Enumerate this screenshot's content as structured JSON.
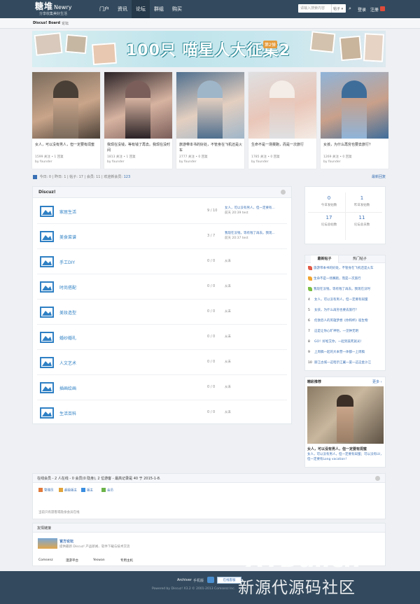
{
  "header": {
    "logo_main": "糖堆",
    "logo_en": "Newry",
    "logo_sub": "分享收集美好生活",
    "nav": [
      "门户",
      "资讯",
      "论坛",
      "群组",
      "购买"
    ],
    "nav_active_index": 2,
    "search_placeholder": "请输入搜索内容",
    "search_scope": "帖子",
    "login": "登录",
    "register": "注册"
  },
  "breadcrumb": {
    "home": "Discuz! Board",
    "sep": "›",
    "current": "论坛"
  },
  "banner": {
    "title": "100只 喵星人大征集2",
    "issue": "第2弹"
  },
  "featured": [
    {
      "title": "女人，可以没有男人，但一定要有闺蜜",
      "meta": "1599 关注 • 1 回复",
      "by": "by founder",
      "colors": [
        "#7a6b5c",
        "#c9a58a",
        "#4a3f36"
      ]
    },
    {
      "title": "我现在没钱，等有钱了再去。我现在没时间",
      "meta": "1813 关注 • 1 回复",
      "by": "by founder",
      "colors": [
        "#2a2226",
        "#d7b3a1",
        "#7b5e5a"
      ]
    },
    {
      "title": "旅游带本书的好处，不管身在飞机还是火车",
      "meta": "2777 关注 • 0 回复",
      "by": "by founder",
      "colors": [
        "#4f6f8e",
        "#e4cfc0",
        "#9fb6c9"
      ]
    },
    {
      "title": "生命不是一场赛跑，而是一次旅行",
      "meta": "1785 关注 • 0 回复",
      "by": "by founder",
      "colors": [
        "#dfe0e2",
        "#e9c6b8",
        "#f4ece6"
      ]
    },
    {
      "title": "女孩，为什么再穷也要去旅行？",
      "meta": "1269 关注 • 0 回复",
      "by": "by founder",
      "colors": [
        "#8fb4d9",
        "#c9a08a",
        "#3f6d9a"
      ]
    }
  ],
  "stats": {
    "today_label": "今日:",
    "today": "0",
    "yesterday_label": "昨日:",
    "yesterday": "1",
    "posts_label": "帖子:",
    "posts": "17",
    "members_label": "会员:",
    "members": "11",
    "welcome_label": "欢迎新会员:",
    "welcome": "123",
    "newest": "最新回复"
  },
  "forum": {
    "title": "Discuz!",
    "rows": [
      {
        "name": "家居生活",
        "count": "9 / 10",
        "last": "女人，可以没有男人，但一定要有...",
        "last_meta": "前天 20:39 test"
      },
      {
        "name": "美食菜谱",
        "count": "3 / 7",
        "last": "我现在没钱，等有钱了再去。我现...",
        "last_meta": "前天 20:37 test"
      },
      {
        "name": "手工DIY",
        "count": "0 / 0",
        "last": "从未",
        "last_meta": ""
      },
      {
        "name": "时尚搭配",
        "count": "0 / 0",
        "last": "从未",
        "last_meta": ""
      },
      {
        "name": "美妆造型",
        "count": "0 / 0",
        "last": "从未",
        "last_meta": ""
      },
      {
        "name": "婚纱婚礼",
        "count": "0 / 0",
        "last": "从未",
        "last_meta": ""
      },
      {
        "name": "人文艺术",
        "count": "0 / 0",
        "last": "从未",
        "last_meta": ""
      },
      {
        "name": "插画绘画",
        "count": "0 / 0",
        "last": "从未",
        "last_meta": ""
      },
      {
        "name": "生活百科",
        "count": "0 / 0",
        "last": "从未",
        "last_meta": ""
      }
    ]
  },
  "side_stats": [
    {
      "num": "0",
      "label": "今日发帖数"
    },
    {
      "num": "1",
      "label": "昨日发帖数"
    },
    {
      "num": "17",
      "label": "论坛总帖数"
    },
    {
      "num": "11",
      "label": "论坛总员数"
    }
  ],
  "hot_tabs": {
    "active": "最新帖子",
    "other": "热门帖子"
  },
  "hot_posts": [
    {
      "rank": "",
      "title": "旅游带本书的好处，不管身在飞机还是火车",
      "leaf": "#e05a47"
    },
    {
      "rank": "",
      "title": "生命不是一场赛跑，而是一次旅行",
      "leaf": "#f0a531"
    },
    {
      "rank": "",
      "title": "我现在没钱，等有钱了再去。我现在没时",
      "leaf": "#7bbf45"
    },
    {
      "rank": "4",
      "title": "女人，可以没有男人，但一定要有闺蜜",
      "leaf": ""
    },
    {
      "rank": "5",
      "title": "女孩，为什么再穷也要去旅行？",
      "leaf": ""
    },
    {
      "rank": "6",
      "title": "伦敦恐人的英雄梦想《你和杯》宿生物",
      "leaf": ""
    },
    {
      "rank": "7",
      "title": "这是让你心旷神怡，一见钟无明",
      "leaf": ""
    },
    {
      "rank": "8",
      "title": "GO！好松艾你，一起到美死就光！",
      "leaf": ""
    },
    {
      "rank": "9",
      "title": "上周稿一起的大本营一体都一上周稿",
      "leaf": ""
    },
    {
      "rank": "10",
      "title": "丽江古城一这昭示江翼一渠一这这金沙江",
      "leaf": ""
    }
  ],
  "recommend": {
    "title": "精彩推荐",
    "more": "更多 ›",
    "post_title": "女人，可以没有男人，但一定要有闺蜜",
    "post_desc": "女人，可以没有男人，但一定要有闺蜜；可以没有LV，但一定要有Long vacation！"
  },
  "online": {
    "title": "在线会员 - 2 人在线 - 0 会员(0 隐身), 2 位游客 - 最高记录是 40 于 2015-1-8.",
    "legend": [
      {
        "label": "管理员",
        "color": "#e07a3b"
      },
      {
        "label": "超级版主",
        "color": "#e0a33b"
      },
      {
        "label": "版主",
        "color": "#3b8ee0"
      },
      {
        "label": "会员",
        "color": "#6bb34a"
      }
    ],
    "note": "当前只有游客或隐身会员在线"
  },
  "links": {
    "title": "友情链接",
    "site": "官方论坛",
    "desc": "提供最新 Discuz! 产品新闻、软件下载与技术交流",
    "items": [
      "Comsenz",
      "漫游平台",
      "Yeswan",
      "专用主机"
    ]
  },
  "footer": {
    "archiver": "Archiver",
    "mobile": "手机版",
    "service": "在线客服",
    "powered": "Powered by Discuz! X3.2 © 2001-2013 Comsenz Inc."
  },
  "watermark": {
    "en": "XYDai.cn",
    "cn": "新源代源码社区"
  }
}
